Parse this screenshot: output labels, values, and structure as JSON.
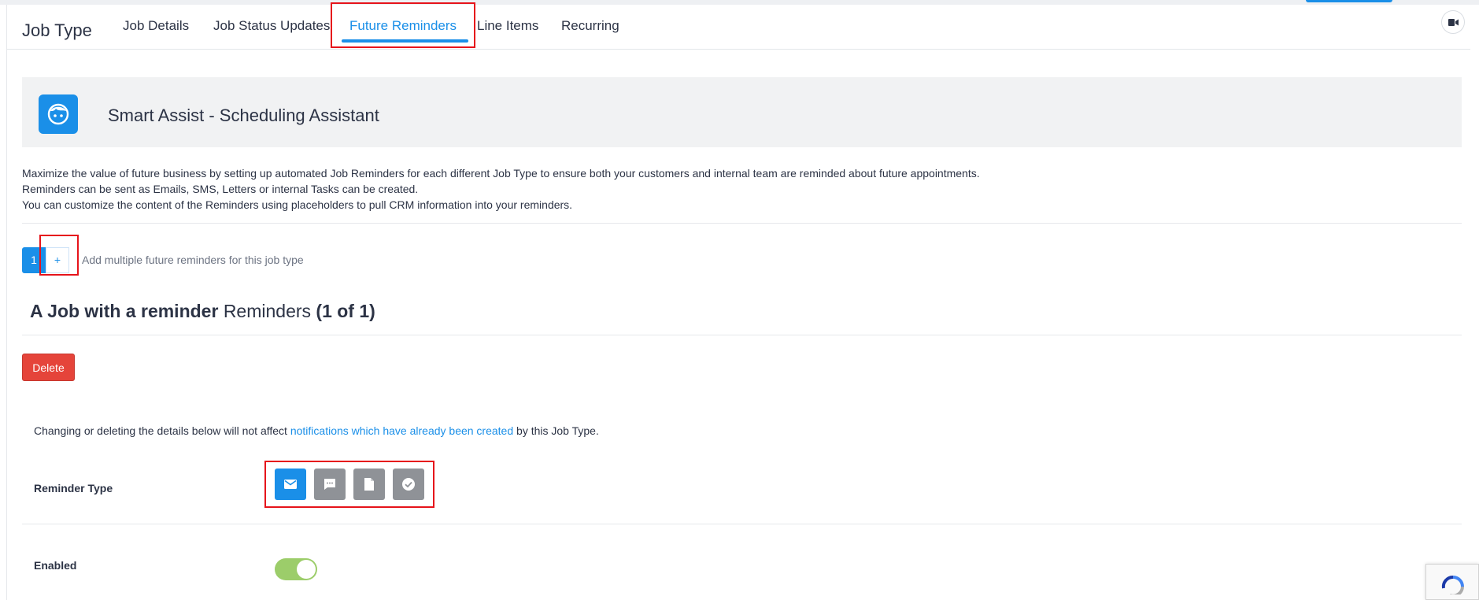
{
  "header": {
    "title": "Job Type",
    "tabs": [
      {
        "label": "Job Details"
      },
      {
        "label": "Job Status Updates"
      },
      {
        "label": "Future Reminders"
      },
      {
        "label": "Line Items"
      },
      {
        "label": "Recurring"
      }
    ]
  },
  "banner": {
    "title": "Smart Assist - Scheduling Assistant"
  },
  "description": {
    "line1": "Maximize the value of future business by setting up automated Job Reminders for each different Job Type to ensure both your customers and internal team are reminded about future appointments.",
    "line2": "Reminders can be sent as Emails, SMS, Letters or internal Tasks can be created.",
    "line3": "You can customize the content of the Reminders using placeholders to pull CRM information into your reminders."
  },
  "pager": {
    "current": "1",
    "add_label": "+",
    "hint": "Add multiple future reminders for this job type"
  },
  "reminder": {
    "title_bold": "A Job with a reminder",
    "title_mid": "Reminders",
    "title_count": "(1 of 1)",
    "delete_label": "Delete",
    "notice_before": "Changing or deleting the details below will not affect",
    "notice_link": "notifications which have already been created",
    "notice_after": "by this Job Type.",
    "type_label": "Reminder Type",
    "types": [
      {
        "icon": "email-icon",
        "active": true
      },
      {
        "icon": "sms-icon",
        "active": false
      },
      {
        "icon": "letter-icon",
        "active": false
      },
      {
        "icon": "task-icon",
        "active": false
      }
    ],
    "enabled_label": "Enabled",
    "enabled": true
  },
  "colors": {
    "accent": "#1a8fe8",
    "danger": "#e5443a",
    "toggle_on": "#9ccd6a",
    "highlight": "#e6141b",
    "inactive_icon": "#8f9297"
  }
}
